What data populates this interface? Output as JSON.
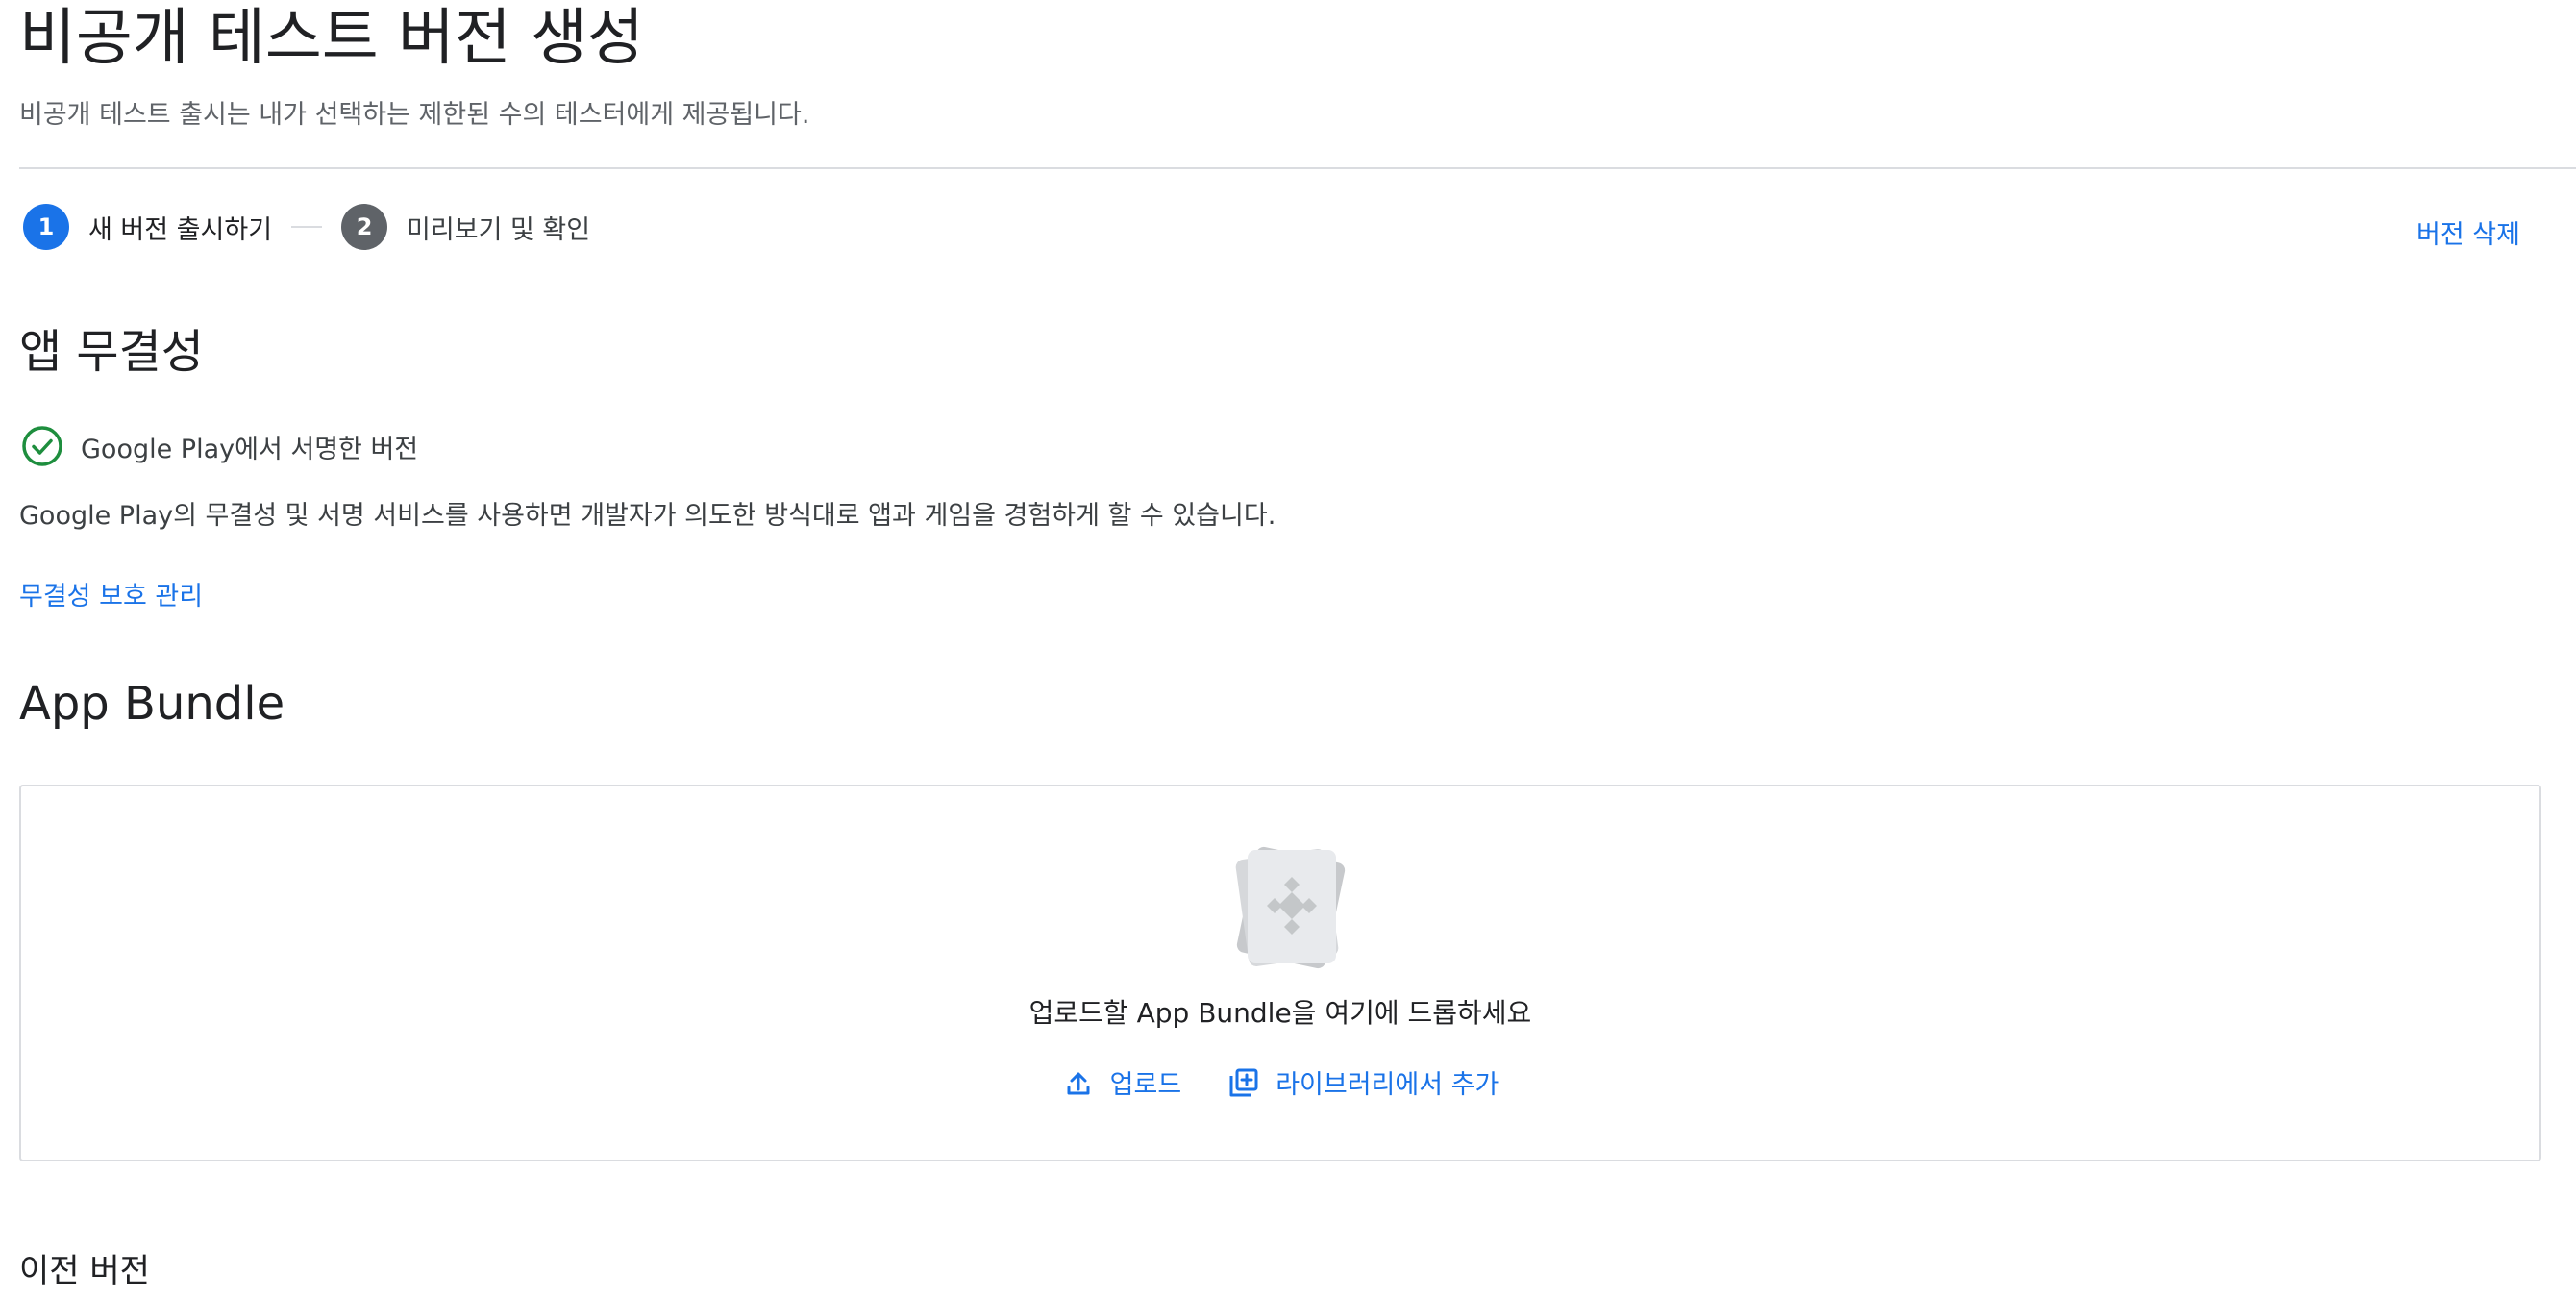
{
  "header": {
    "title": "비공개 테스트 버전 생성",
    "subtitle": "비공개 테스트 출시는 내가 선택하는 제한된 수의 테스터에게 제공됩니다."
  },
  "stepper": {
    "steps": [
      {
        "number": "1",
        "label": "새 버전 출시하기",
        "state": "active"
      },
      {
        "number": "2",
        "label": "미리보기 및 확인",
        "state": "inactive"
      }
    ],
    "delete_label": "버전 삭제"
  },
  "integrity": {
    "title": "앱 무결성",
    "status_icon": "check-circle-icon",
    "status_text": "Google Play에서 서명한 버전",
    "description": "Google Play의 무결성 및 서명 서비스를 사용하면 개발자가 의도한 방식대로 앱과 게임을 경험하게 할 수 있습니다.",
    "manage_link": "무결성 보호 관리"
  },
  "app_bundle": {
    "title": "App Bundle",
    "drop_text": "업로드할 App Bundle을 여기에 드롭하세요",
    "upload_label": "업로드",
    "upload_icon": "upload-icon",
    "library_label": "라이브러리에서 추가",
    "library_icon": "library-add-icon"
  },
  "previous_versions": {
    "title": "이전 버전"
  },
  "colors": {
    "accent": "#1a73e8",
    "success": "#1e8e3e",
    "text_primary": "#202124",
    "text_secondary": "#5f6368",
    "divider": "#dadce0"
  }
}
